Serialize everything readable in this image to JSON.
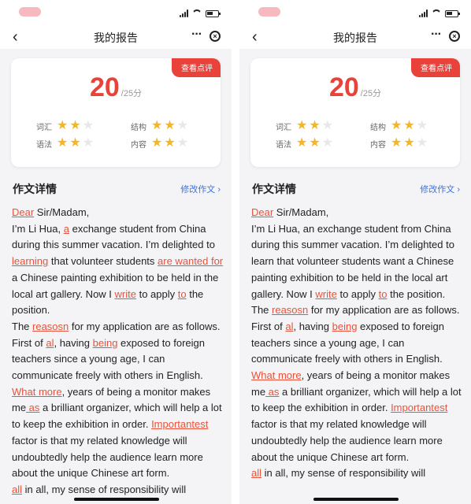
{
  "nav": {
    "back_icon": "‹",
    "title": "我的报告",
    "more_icon": "···",
    "close_icon": "×"
  },
  "card": {
    "badge": "查看点评",
    "score": "20",
    "total": "/25分",
    "dims": [
      {
        "label": "词汇",
        "stars": 2,
        "max": 3
      },
      {
        "label": "结构",
        "stars": 2,
        "max": 3
      },
      {
        "label": "语法",
        "stars": 2,
        "max": 3
      },
      {
        "label": "内容",
        "stars": 2,
        "max": 3
      }
    ]
  },
  "section": {
    "title": "作文详情",
    "edit_label": "修改作文",
    "edit_arrow": "›"
  },
  "colors": {
    "accent": "#e9423a",
    "star": "#f5b622",
    "link": "#3a74e0"
  },
  "left_essay": [
    {
      "t": "Dear",
      "e": true
    },
    {
      "t": " Sir/Madam,"
    },
    {
      "br": true
    },
    {
      "t": "I’m Li Hua, "
    },
    {
      "t": "a",
      "e": true
    },
    {
      "t": " exchange student from China during this summer vacation. I’m delighted to "
    },
    {
      "t": "learning",
      "e": true
    },
    {
      "t": " that volunteer students "
    },
    {
      "t": "are wanted for",
      "e": true
    },
    {
      "t": " a Chinese painting exhibition to be held in the local art gallery. Now I "
    },
    {
      "t": "write",
      "e": true
    },
    {
      "t": " to apply "
    },
    {
      "t": "to",
      "e": true
    },
    {
      "t": " the position."
    },
    {
      "br": true
    },
    {
      "t": "The "
    },
    {
      "t": "reasosn",
      "e": true
    },
    {
      "t": " for my application are as follows. First of "
    },
    {
      "t": "al",
      "e": true
    },
    {
      "t": ", having "
    },
    {
      "t": "being",
      "e": true
    },
    {
      "t": " exposed to foreign teachers since a young age, I can communicate freely with others in English. "
    },
    {
      "t": "What more",
      "e": true
    },
    {
      "t": ", years of being a monitor makes me"
    },
    {
      "t": " as",
      "e": true
    },
    {
      "t": " a brilliant organizer, which will help a lot to keep the exhibition in order. "
    },
    {
      "t": "Importantest",
      "e": true
    },
    {
      "t": " factor is that my related knowledge will undoubtedly help the audience learn more about the unique Chinese art form."
    },
    {
      "br": true
    },
    {
      "t": "all",
      "e": true
    },
    {
      "t": " in all, my sense of responsibility will"
    }
  ],
  "right_essay": [
    {
      "t": "Dear",
      "e": true
    },
    {
      "t": " Sir/Madam,"
    },
    {
      "br": true
    },
    {
      "t": "I’m Li Hua, an exchange student from China during this summer vacation. I’m delighted to learn that volunteer students want a Chinese painting exhibition to be held in the local art gallery. Now I "
    },
    {
      "t": "write",
      "e": true
    },
    {
      "t": " to apply "
    },
    {
      "t": "to",
      "e": true
    },
    {
      "t": " the position."
    },
    {
      "br": true
    },
    {
      "t": "The "
    },
    {
      "t": "reasosn",
      "e": true
    },
    {
      "t": " for my application are as follows. First of "
    },
    {
      "t": "al",
      "e": true
    },
    {
      "t": ", having "
    },
    {
      "t": "being",
      "e": true
    },
    {
      "t": " exposed to foreign teachers since a young age, I can communicate freely with others in English. "
    },
    {
      "t": "What more",
      "e": true
    },
    {
      "t": ", years of being a monitor makes me"
    },
    {
      "t": " as",
      "e": true
    },
    {
      "t": " a brilliant organizer, which will help a lot to keep the exhibition in order. "
    },
    {
      "t": "Importantest",
      "e": true
    },
    {
      "t": " factor is that my related knowledge will undoubtedly help the audience learn more about the unique Chinese art form."
    },
    {
      "br": true
    },
    {
      "t": "all",
      "e": true
    },
    {
      "t": " in all, my sense of responsibility will"
    }
  ]
}
